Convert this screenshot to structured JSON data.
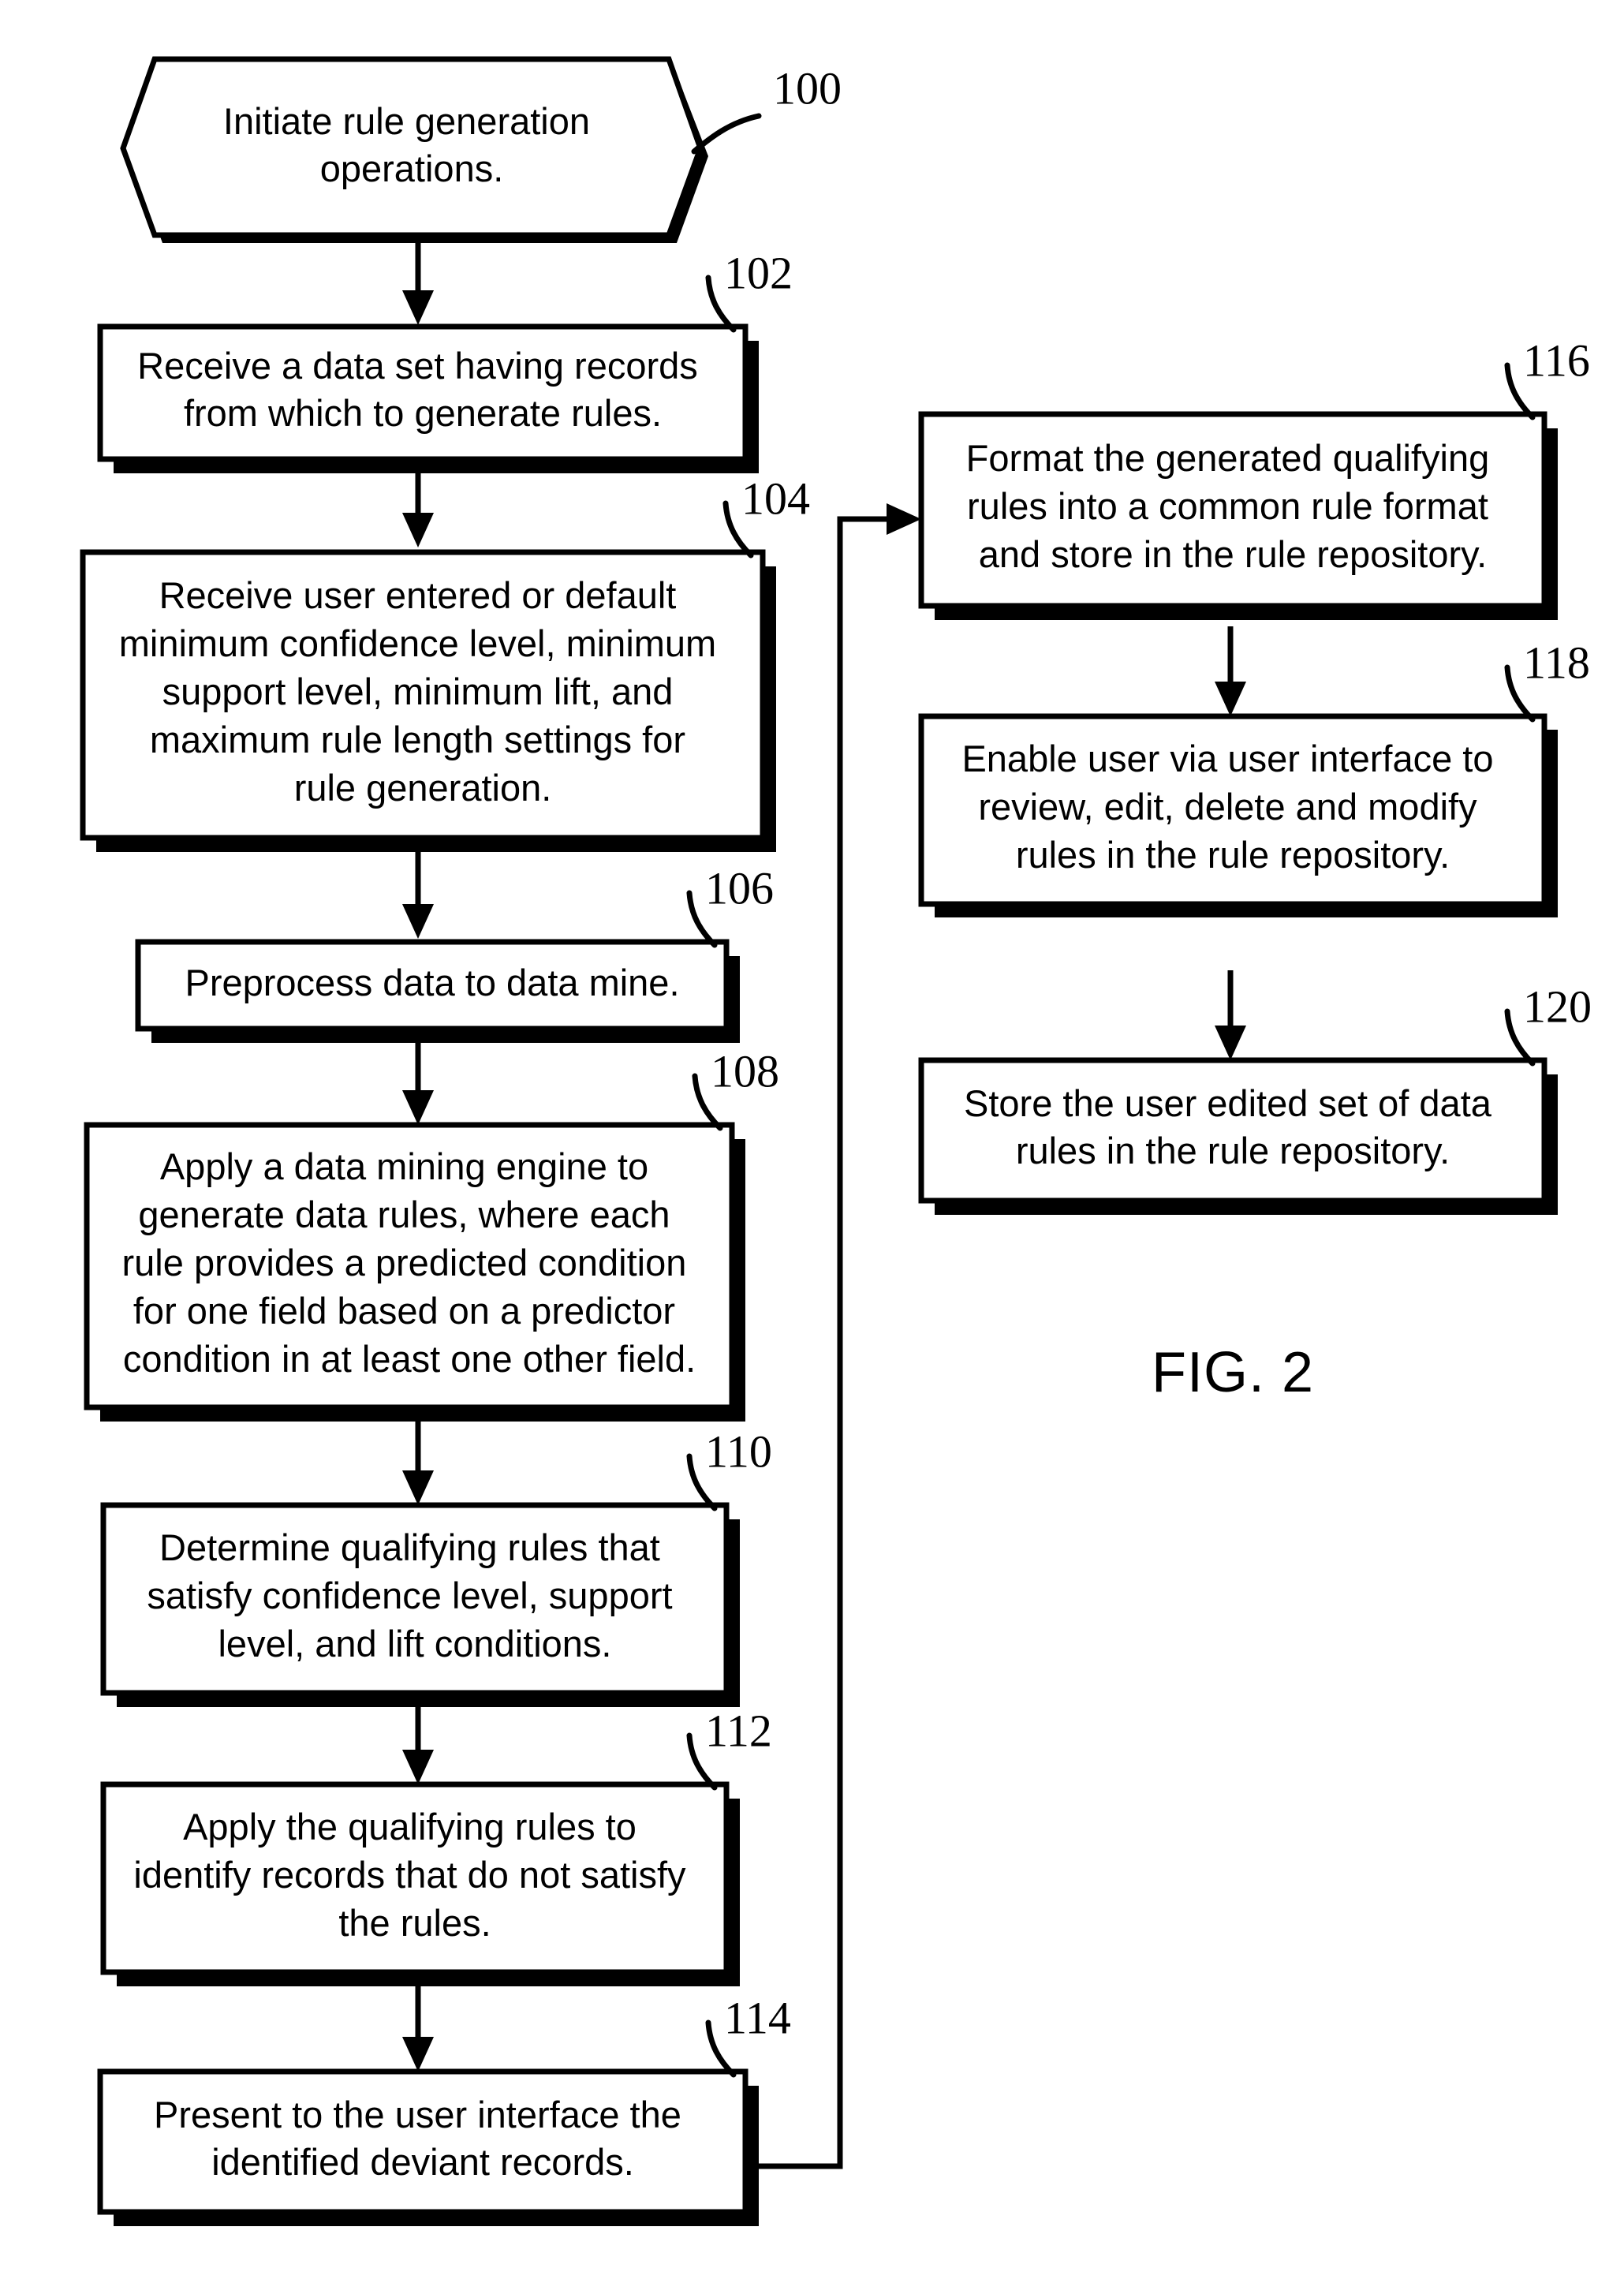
{
  "figure": {
    "label": "FIG. 2",
    "title": "Rule generation operations flowchart"
  },
  "nodes": [
    {
      "id": "100",
      "ref": "100",
      "shape": "hexagon",
      "lines": [
        "Initiate rule generation",
        "operations."
      ],
      "text": "Initiate rule generation operations."
    },
    {
      "id": "102",
      "ref": "102",
      "shape": "rect",
      "lines": [
        "Receive a data set having records",
        "from which to generate rules."
      ],
      "text": "Receive a data set having records from which to generate rules."
    },
    {
      "id": "104",
      "ref": "104",
      "shape": "rect",
      "lines": [
        "Receive user entered or default",
        "minimum confidence level, minimum",
        "support level, minimum lift, and",
        "maximum rule length settings for",
        "rule generation."
      ],
      "text": "Receive user entered or default minimum confidence level, minimum support level, minimum lift, and maximum rule length settings for rule generation."
    },
    {
      "id": "106",
      "ref": "106",
      "shape": "rect",
      "lines": [
        "Preprocess data to data mine."
      ],
      "text": "Preprocess data to data mine."
    },
    {
      "id": "108",
      "ref": "108",
      "shape": "rect",
      "lines": [
        "Apply a data mining engine to",
        "generate data rules, where each",
        "rule provides a predicted condition",
        "for one field based on a predictor",
        "condition in at least one other field."
      ],
      "text": "Apply a data mining engine to generate data rules, where each rule provides a predicted condition for one field based on a predictor condition in at least one other field."
    },
    {
      "id": "110",
      "ref": "110",
      "shape": "rect",
      "lines": [
        "Determine qualifying rules that",
        "satisfy confidence level, support",
        "level, and lift conditions."
      ],
      "text": "Determine qualifying rules that satisfy confidence level, support level, and lift conditions."
    },
    {
      "id": "112",
      "ref": "112",
      "shape": "rect",
      "lines": [
        "Apply the qualifying rules to",
        "identify records that do not satisfy",
        "the rules."
      ],
      "text": "Apply the qualifying rules to identify records that do not satisfy the rules."
    },
    {
      "id": "114",
      "ref": "114",
      "shape": "rect",
      "lines": [
        "Present to the user interface the",
        "identified deviant records."
      ],
      "text": "Present to the user interface the identified deviant records."
    },
    {
      "id": "116",
      "ref": "116",
      "shape": "rect",
      "lines": [
        "Format the generated qualifying",
        "rules into a common rule format",
        "and store in the rule repository."
      ],
      "text": "Format the generated qualifying rules into a common rule format and store in the rule repository."
    },
    {
      "id": "118",
      "ref": "118",
      "shape": "rect",
      "lines": [
        "Enable user via user interface to",
        "review, edit, delete and modify",
        "rules in the rule repository."
      ],
      "text": "Enable user via user interface to review, edit, delete and modify rules in the rule repository."
    },
    {
      "id": "120",
      "ref": "120",
      "shape": "rect",
      "lines": [
        "Store the user edited set of data",
        "rules in the rule repository."
      ],
      "text": "Store the user edited set of data rules in the rule repository."
    }
  ],
  "edges": [
    {
      "from": "100",
      "to": "102",
      "kind": "down-arrow"
    },
    {
      "from": "102",
      "to": "104",
      "kind": "down-arrow"
    },
    {
      "from": "104",
      "to": "106",
      "kind": "down-arrow"
    },
    {
      "from": "106",
      "to": "108",
      "kind": "down-arrow"
    },
    {
      "from": "108",
      "to": "110",
      "kind": "down-arrow"
    },
    {
      "from": "110",
      "to": "112",
      "kind": "down-arrow"
    },
    {
      "from": "112",
      "to": "114",
      "kind": "down-arrow"
    },
    {
      "from": "114",
      "to": "116",
      "kind": "right-up-arrow"
    },
    {
      "from": "116",
      "to": "118",
      "kind": "down-arrow"
    },
    {
      "from": "118",
      "to": "120",
      "kind": "down-arrow"
    }
  ],
  "colors": {
    "stroke": "#000000",
    "fill": "#ffffff",
    "background": "#ffffff"
  }
}
